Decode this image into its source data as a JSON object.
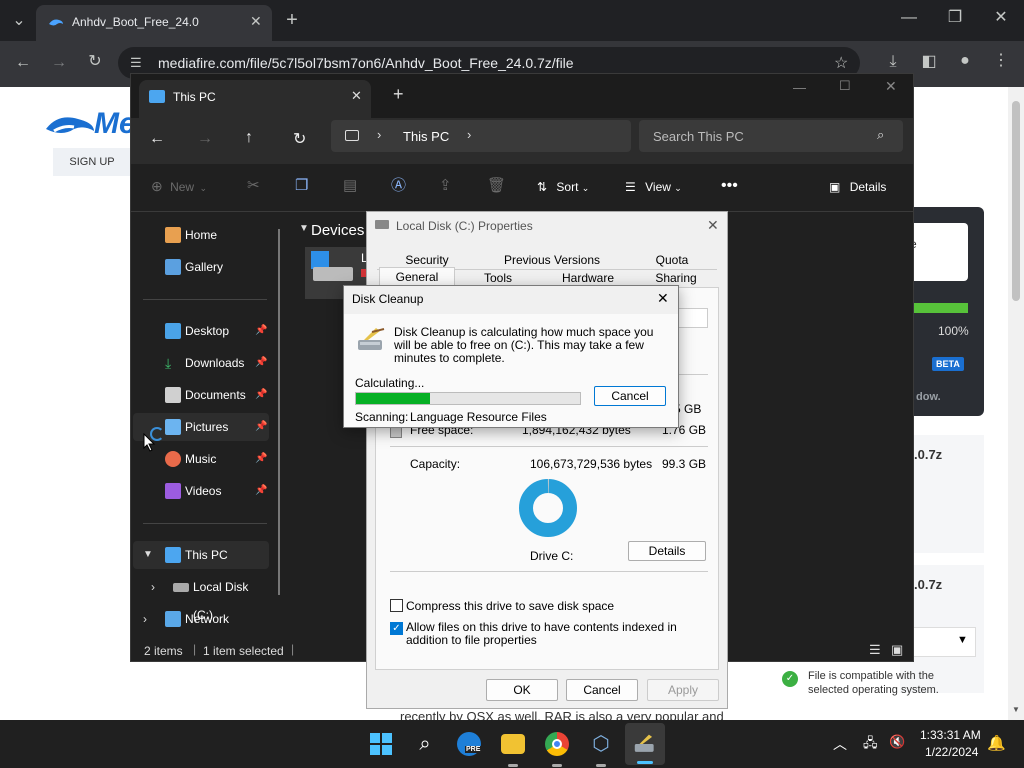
{
  "browser": {
    "tab_title": "Anhdv_Boot_Free_24.0",
    "url": "mediafire.com/file/5c7l5ol7bsm7on6/Anhdv_Boot_Free_24.0.7z/file"
  },
  "webpage": {
    "logo_text": "Me",
    "signup_label": "SIGN UP",
    "panel_text_fragment": "ete",
    "progress_percent": "100%",
    "beta_badge": "BETA",
    "window_text_fragment": "dow.",
    "filename_fragment_1": ".0.7z",
    "filename_fragment_2": ".0.7z",
    "compat_text": "File is compatible with the selected operating system.",
    "bottom_text": "recently by OSX as well. RAR is also a very popular and"
  },
  "explorer": {
    "tab_title": "This PC",
    "breadcrumb": "This PC",
    "search_placeholder": "Search This PC",
    "toolbar": {
      "new_label": "New",
      "sort_label": "Sort",
      "view_label": "View",
      "details_label": "Details"
    },
    "nav": {
      "home": "Home",
      "gallery": "Gallery",
      "desktop": "Desktop",
      "downloads": "Downloads",
      "documents": "Documents",
      "pictures": "Pictures",
      "music": "Music",
      "videos": "Videos",
      "this_pc": "This PC",
      "local_disk": "Local Disk (C:)",
      "network": "Network"
    },
    "section_header": "Devices",
    "drive_label_fragment": "L",
    "status": {
      "items": "2 items",
      "selected": "1 item selected"
    }
  },
  "properties": {
    "title": "Local Disk (C:) Properties",
    "tabs_row1": [
      "Security",
      "Previous Versions",
      "Quota"
    ],
    "tabs_row2": [
      "General",
      "Tools",
      "Hardware",
      "Sharing"
    ],
    "used_size_fragment": "5 GB",
    "free_label": "Free space:",
    "free_bytes": "1,894,162,432 bytes",
    "free_size": "1.76 GB",
    "capacity_label": "Capacity:",
    "capacity_bytes": "106,673,729,536 bytes",
    "capacity_size": "99.3 GB",
    "drive_label": "Drive C:",
    "details_button": "Details",
    "compress_label": "Compress this drive to save disk space",
    "compress_checked": false,
    "index_label": "Allow files on this drive to have contents indexed in addition to file properties",
    "index_checked": true,
    "ok_button": "OK",
    "cancel_button": "Cancel",
    "apply_button": "Apply"
  },
  "cleanup": {
    "title": "Disk Cleanup",
    "message": "Disk Cleanup is calculating how much space you will be able to free on  (C:). This may take a few minutes to complete.",
    "calculating_label": "Calculating...",
    "progress": 0.33,
    "cancel_button": "Cancel",
    "scanning_label": "Scanning:",
    "scanning_item": "Language Resource Files"
  },
  "taskbar": {
    "time": "1:33:31 AM",
    "date": "1/22/2024",
    "pre_badge": "PRE"
  },
  "colors": {
    "accent": "#0078d4",
    "progress_green": "#06b025",
    "mediafire_blue": "#1a6fd1",
    "explorer_bg": "#202020"
  }
}
